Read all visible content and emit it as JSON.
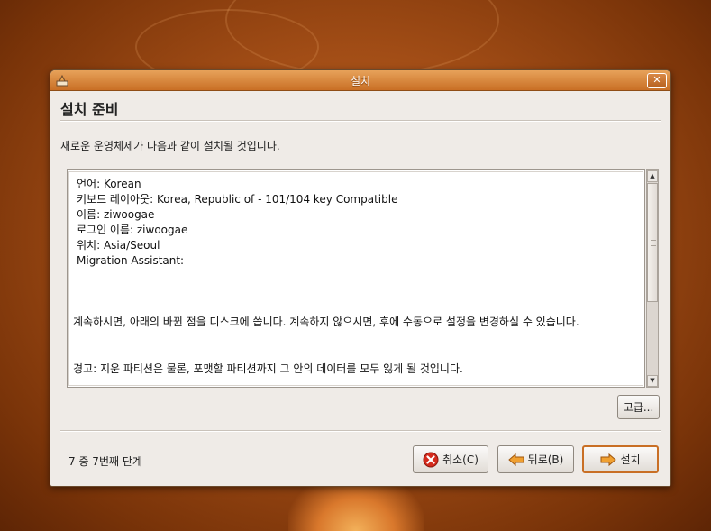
{
  "window": {
    "title": "설치",
    "close_label": "✕"
  },
  "page": {
    "header": "설치 준비",
    "intro": "새로운 운영체제가 다음과 같이 설치될 것입니다."
  },
  "summary": {
    "lines": [
      "언어: Korean",
      "키보드 레이아웃: Korea, Republic of - 101/104 key Compatible",
      "이름: ziwoogae",
      "로그인 이름: ziwoogae",
      "위치: Asia/Seoul",
      "Migration Assistant:"
    ],
    "continue_notice": "계속하시면, 아래의 바뀐 점을 디스크에 씁니다. 계속하지 않으시면, 후에 수동으로 설정을 변경하실 수 있습니다.",
    "warning": "경고: 지운 파티션은 물론, 포맷할 파티션까지 그 안의 데이터를 모두 잃게 될 것입니다."
  },
  "buttons": {
    "advanced": "고급...",
    "cancel": "취소(C)",
    "back": "뒤로(B)",
    "install": "설치"
  },
  "footer": {
    "step": "7 중 7번째 단계"
  },
  "colors": {
    "accent": "#c96f25",
    "titlebar_top": "#e7a25a",
    "titlebar_bottom": "#c96f25",
    "cancel_icon": "#d42a1c",
    "arrow_icon": "#f0a030"
  }
}
